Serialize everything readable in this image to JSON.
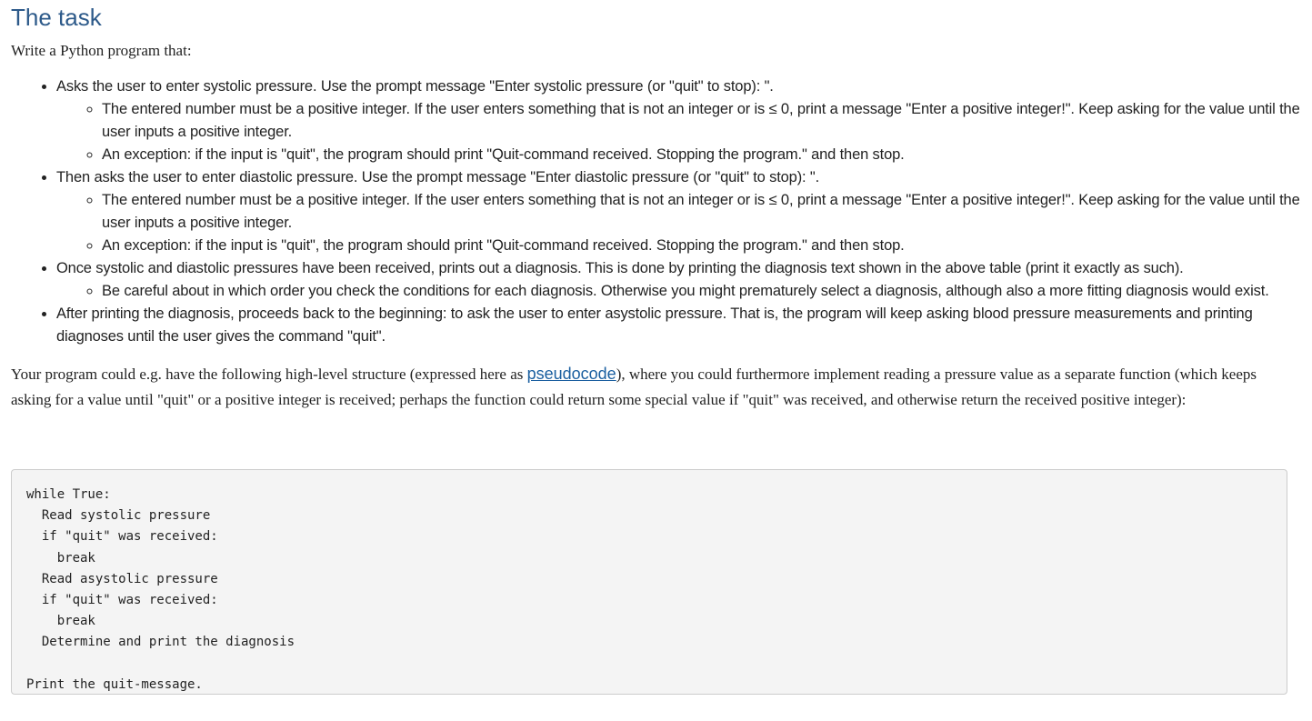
{
  "title": "The task",
  "intro": "Write a Python program that:",
  "tasks": [
    {
      "text": "Asks the user to enter systolic pressure. Use the prompt message \"Enter systolic pressure (or \"quit\" to stop): \".",
      "subitems": [
        "The entered number must be a positive integer. If the user enters something that is not an integer or is ≤ 0, print a message \"Enter a positive integer!\". Keep asking for the value until the user inputs a positive integer.",
        "An exception: if the input is \"quit\", the program should print \"Quit-command received. Stopping the program.\" and then stop."
      ]
    },
    {
      "text": "Then asks the user to enter diastolic pressure. Use the prompt message \"Enter diastolic pressure (or \"quit\" to stop): \".",
      "subitems": [
        "The entered number must be a positive integer. If the user enters something that is not an integer or is ≤ 0, print a message \"Enter a positive integer!\". Keep asking for the value until the user inputs a positive integer.",
        "An exception: if the input is \"quit\", the program should print \"Quit-command received. Stopping the program.\" and then stop."
      ]
    },
    {
      "text": "Once systolic and diastolic pressures have been received, prints out a diagnosis. This is done by printing the diagnosis text shown in the above table (print it exactly as such).",
      "subitems": [
        "Be careful about in which order you check the conditions for each diagnosis. Otherwise you might prematurely select a diagnosis, although also a more fitting diagnosis would exist."
      ]
    },
    {
      "text": "After printing the diagnosis, proceeds back to the beginning: to ask the user to enter asystolic pressure. That is, the program will keep asking blood pressure measurements and printing diagnoses until the user gives the command \"quit\".",
      "subitems": []
    }
  ],
  "structure": {
    "before_link": "Your program could e.g. have the following high-level structure (expressed here as ",
    "link_text": "pseudocode",
    "after_link": "), where you could furthermore implement reading a pressure value as a separate function (which keeps asking for a value until \"quit\" or a positive integer is received; perhaps the function could return some special value if \"quit\" was received, and otherwise return the received positive integer):"
  },
  "code": "while True:\n  Read systolic pressure\n  if \"quit\" was received:\n    break\n  Read asystolic pressure\n  if \"quit\" was received:\n    break\n  Determine and print the diagnosis\n\nPrint the quit-message."
}
